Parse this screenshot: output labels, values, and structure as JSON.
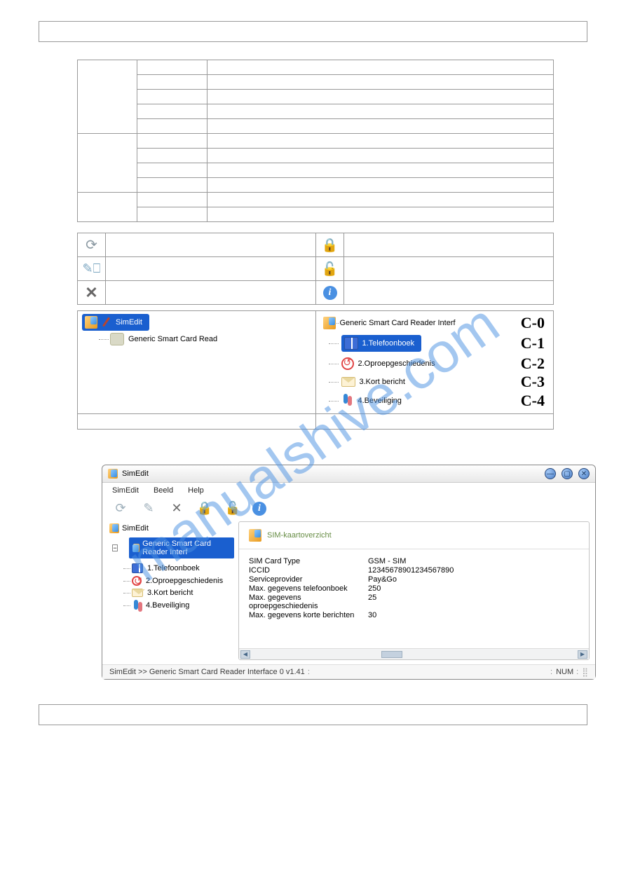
{
  "watermark": "manualshive.com",
  "tree_a": {
    "root": "SimEdit",
    "reader": "Generic Smart Card Read"
  },
  "tree_b": {
    "reader": "Generic Smart Card Reader Interf",
    "items": [
      {
        "label": "1.Telefoonboek",
        "code": "C-1"
      },
      {
        "label": "2.Oproepgeschiedenis",
        "code": "C-2"
      },
      {
        "label": "3.Kort bericht",
        "code": "C-3"
      },
      {
        "label": "4.Beveiliging",
        "code": "C-4"
      }
    ],
    "c0": "C-0"
  },
  "scr": {
    "title": "SimEdit",
    "menu": {
      "a": "SimEdit",
      "b": "Beeld",
      "c": "Help"
    },
    "sidebar": {
      "root": "SimEdit",
      "reader": "Generic Smart Card Reader Interf",
      "items": [
        "1.Telefoonboek",
        "2.Oproepgeschiedenis",
        "3.Kort bericht",
        "4.Beveiliging"
      ]
    },
    "panel_title": "SIM-kaartoverzicht",
    "details": {
      "rows": [
        {
          "k": "SIM Card Type",
          "v": "GSM - SIM"
        },
        {
          "k": "ICCID",
          "v": "12345678901234567890"
        },
        {
          "k": "Serviceprovider",
          "v": "Pay&Go"
        },
        {
          "k": "Max. gegevens telefoonboek",
          "v": "250"
        },
        {
          "k": "Max. gegevens oproepgeschiedenis",
          "v": "25"
        },
        {
          "k": "Max. gegevens korte berichten",
          "v": "30"
        }
      ]
    },
    "status": "SimEdit  >>  Generic Smart Card Reader Interface 0  v1.41",
    "num": "NUM"
  }
}
